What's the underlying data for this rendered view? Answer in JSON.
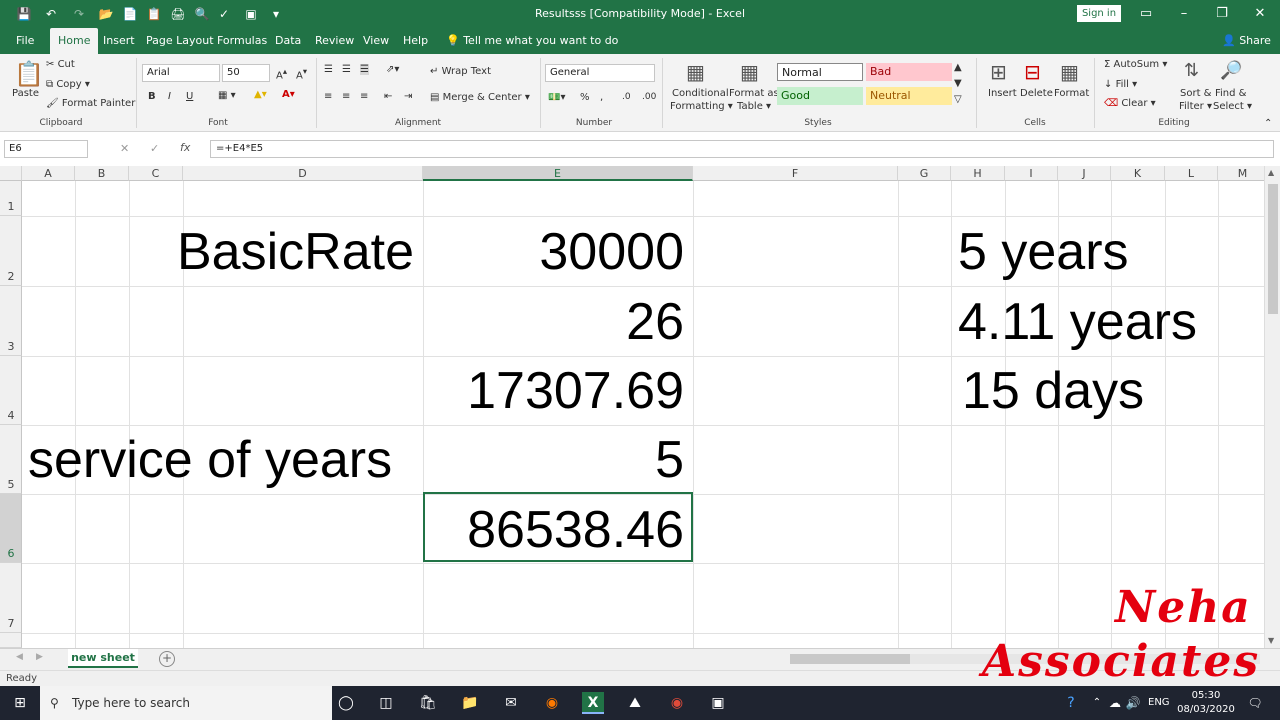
{
  "window": {
    "title": "Resultsss  [Compatibility Mode]  -  Excel",
    "sign_in": "Sign in"
  },
  "tabs": [
    "File",
    "Home",
    "Insert",
    "Page Layout",
    "Formulas",
    "Data",
    "Review",
    "View",
    "Help"
  ],
  "active_tab": "Home",
  "tell_me": "Tell me what you want to do",
  "share": "Share",
  "ribbon": {
    "clipboard": {
      "label": "Clipboard",
      "paste": "Paste",
      "cut": "Cut",
      "copy": "Copy",
      "format_painter": "Format Painter"
    },
    "font": {
      "label": "Font",
      "family": "Arial",
      "size": "50"
    },
    "alignment": {
      "label": "Alignment",
      "wrap": "Wrap Text",
      "merge": "Merge & Center"
    },
    "number": {
      "label": "Number",
      "format": "General"
    },
    "styles": {
      "label": "Styles",
      "conditional": "Conditional",
      "conditional2": "Formatting",
      "format_as": "Format as",
      "table": "Table",
      "normal": "Normal",
      "bad": "Bad",
      "good": "Good",
      "neutral": "Neutral"
    },
    "cells": {
      "label": "Cells",
      "insert": "Insert",
      "delete": "Delete",
      "format": "Format"
    },
    "editing": {
      "label": "Editing",
      "autosum": "AutoSum",
      "fill": "Fill",
      "clear": "Clear",
      "sort": "Sort &",
      "filter": "Filter",
      "find": "Find &",
      "select": "Select"
    }
  },
  "name_box": "E6",
  "formula": "=+E4*E5",
  "columns": [
    "A",
    "B",
    "C",
    "D",
    "E",
    "F",
    "G",
    "H",
    "I",
    "J",
    "K",
    "L",
    "M"
  ],
  "rows": [
    "1",
    "2",
    "3",
    "4",
    "5",
    "6",
    "7"
  ],
  "cells": {
    "D2": "BasicRate",
    "E2": "30000",
    "E3": "26",
    "E4": "17307.69",
    "D5": "service of years",
    "E5": "5",
    "E6": "86538.46",
    "H2": "5 years",
    "H3": "4.11 years",
    "H4": "15 days"
  },
  "sheet_tab": "new sheet",
  "status": "Ready",
  "taskbar": {
    "search": "Type here to search",
    "lang": "ENG",
    "time": "05:30",
    "date": "08/03/2020"
  },
  "watermark": {
    "line1": "Neha",
    "line2": "Associates"
  },
  "colors": {
    "excel_green": "#217346",
    "bad_bg": "#ffc7ce",
    "good_bg": "#c6efce",
    "neutral_bg": "#ffeb9c"
  }
}
